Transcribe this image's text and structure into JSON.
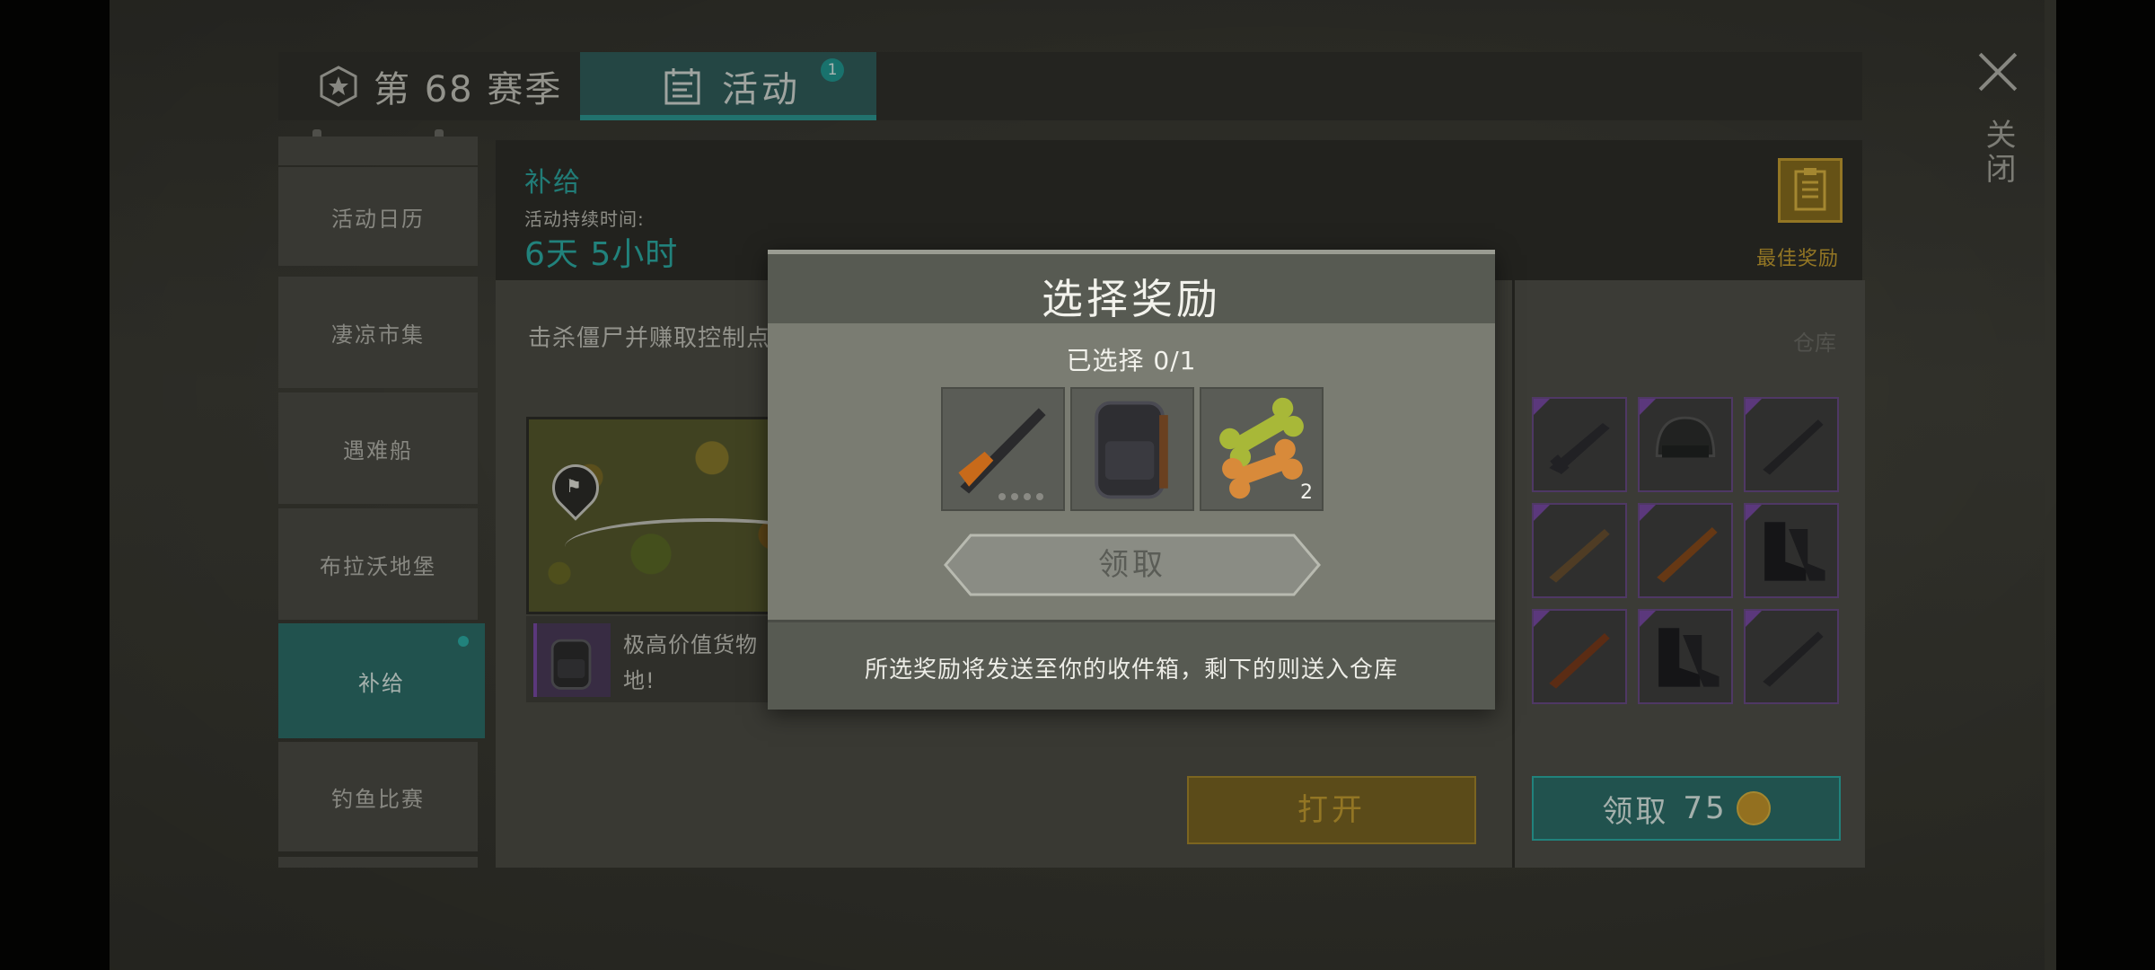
{
  "header": {
    "season_label": "第 68 赛季",
    "activity_tab_label": "活动",
    "activity_badge": "1"
  },
  "close": {
    "label": "关闭"
  },
  "sidebar": {
    "items": [
      {
        "label": "活动日历"
      },
      {
        "label": "凄凉市集"
      },
      {
        "label": "遇难船"
      },
      {
        "label": "布拉沃地堡"
      },
      {
        "label": "补给"
      },
      {
        "label": "钓鱼比赛"
      }
    ],
    "active_index": 4
  },
  "event": {
    "title": "补给",
    "duration_label": "活动持续时间:",
    "duration_value": "6天 5小时",
    "best_reward_label": "最佳奖励",
    "objective": "击杀僵尸并赚取控制点",
    "warehouse_label": "仓库",
    "description": "极高价值货物\n地!",
    "open_button": "打开",
    "claim_button": "领取",
    "claim_cost": "75"
  },
  "modal": {
    "title": "选择奖励",
    "selected_text": "已选择 0/1",
    "options": [
      {
        "icon": "rifle-icon",
        "count": ""
      },
      {
        "icon": "backpack-icon",
        "count": ""
      },
      {
        "icon": "dog-treat-icon",
        "count": "2"
      }
    ],
    "receive_button": "领取",
    "footer_note": "所选奖励将发送至你的收件箱，剩下的则送入仓库"
  },
  "colors": {
    "accent_teal": "#2ab0aa",
    "gold": "#c8a030",
    "rarity_purple": "#7a4aaa"
  }
}
